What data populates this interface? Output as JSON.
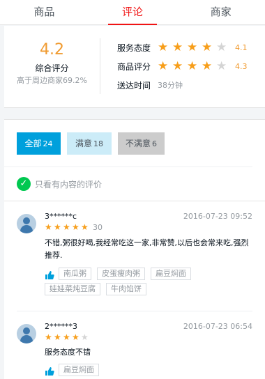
{
  "tabs": [
    {
      "label": "商品",
      "active": false
    },
    {
      "label": "评论",
      "active": true
    },
    {
      "label": "商家",
      "active": false
    }
  ],
  "overview": {
    "score": "4.2",
    "score_title": "综合评分",
    "rank": "高于周边商家69.2%",
    "service_label": "服务态度",
    "service_stars": 4,
    "service_value": "4.1",
    "food_label": "商品评分",
    "food_stars": 4,
    "food_value": "4.3",
    "delivery_label": "送达时间",
    "delivery_value": "38分钟"
  },
  "filter": {
    "all_label": "全部",
    "all_count": "24",
    "positive_label": "满意",
    "positive_count": "18",
    "negative_label": "不满意",
    "negative_count": "6",
    "only_content": "只看有内容的评价"
  },
  "ratings": [
    {
      "username": "3******c",
      "time": "2016-07-23 09:52",
      "stars": 5,
      "delivery": "30",
      "text": "不错,粥很好喝,我经常吃这一家,非常赞,以后也会常来吃,强烈推荐.",
      "recommend": [
        "南瓜粥",
        "皮蛋瘦肉粥",
        "扁豆焖面",
        "娃娃菜炖豆腐",
        "牛肉馅饼"
      ]
    },
    {
      "username": "2******3",
      "time": "2016-07-23 06:54",
      "stars": 4,
      "delivery": "",
      "text": "服务态度不错",
      "recommend": [
        "扁豆焖面"
      ]
    }
  ],
  "colors": {
    "accent_red": "#f01414",
    "star_orange": "#f79e1a",
    "all_blue": "#00a0dc",
    "check_green": "#00c850"
  }
}
